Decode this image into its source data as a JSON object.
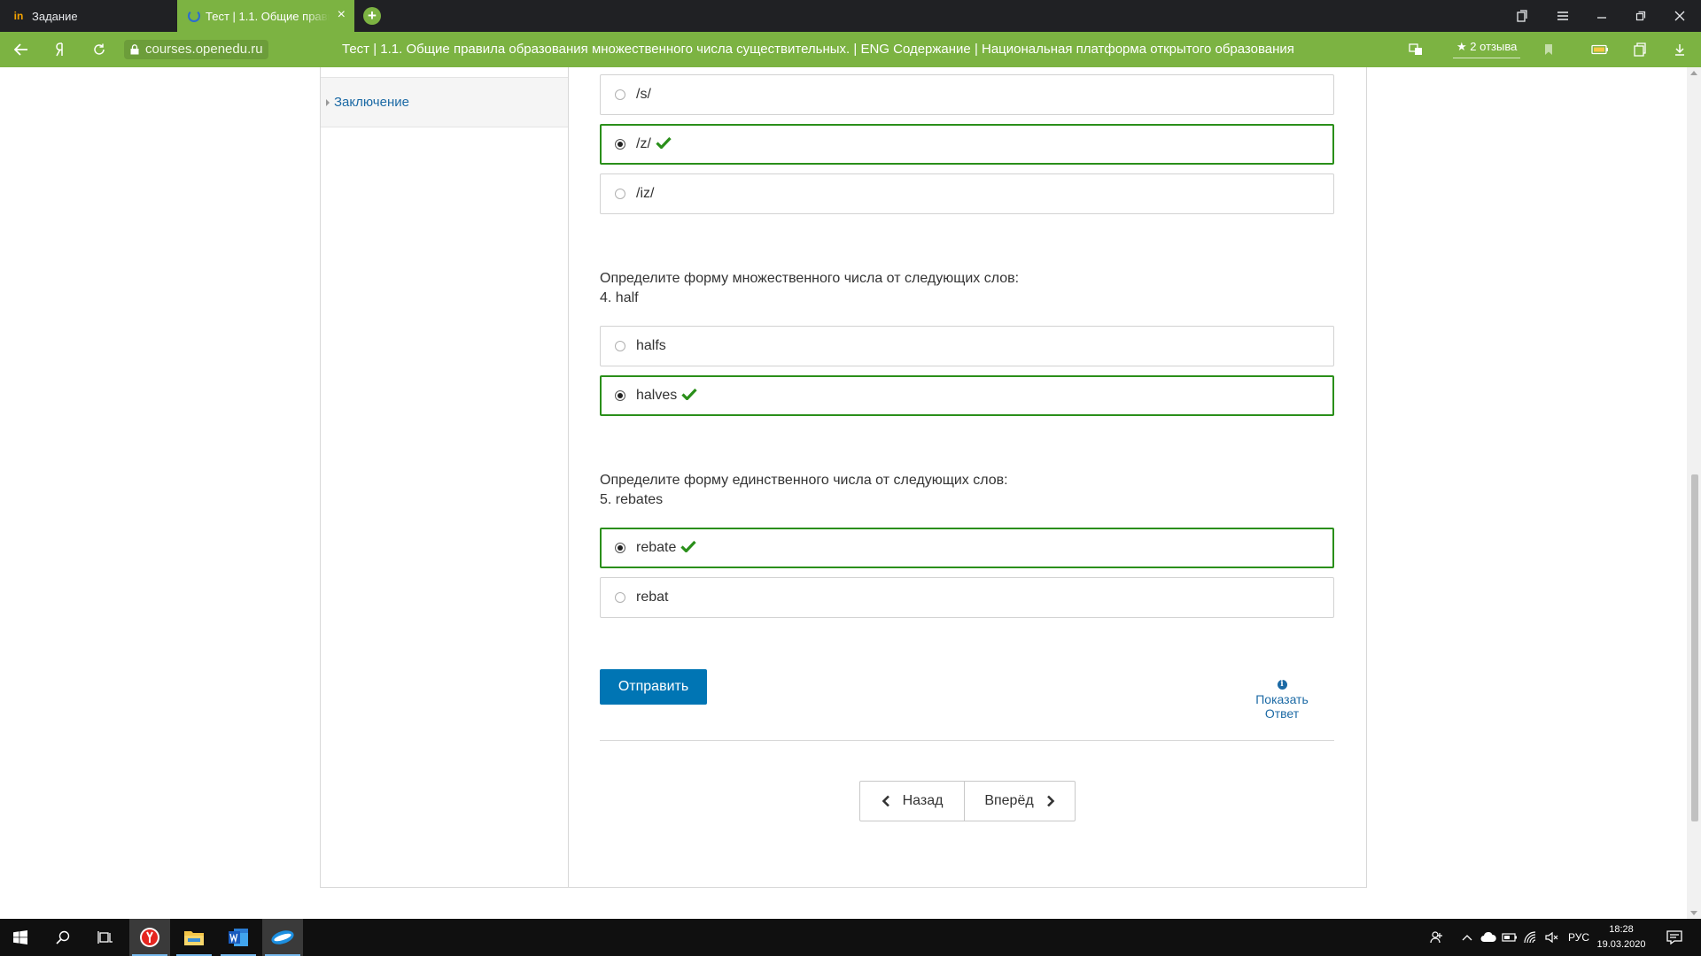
{
  "browser": {
    "tabs": [
      {
        "label": "Задание",
        "favicon": "in"
      },
      {
        "label": "Тест | 1.1. Общие правила образования",
        "favicon": "openedu-logo"
      }
    ],
    "close_glyph": "×",
    "new_tab_glyph": "+",
    "url": "courses.openedu.ru",
    "page_title": "Тест | 1.1. Общие правила образования множественного числа существительных. | ENG Содержание | Национальная платформа открытого образования",
    "reviews": "2 отзыва",
    "accent_color": "#7cb342"
  },
  "sidebar": {
    "items": [
      {
        "label": "Заключение"
      }
    ]
  },
  "quiz": {
    "q3_options": [
      {
        "label": "/s/",
        "selected": false
      },
      {
        "label": "/z/",
        "selected": true,
        "correct": true
      },
      {
        "label": "/iz/",
        "selected": false
      }
    ],
    "q4": {
      "prompt": "Определите форму множественного числа от следующих слов:",
      "word": "4. half",
      "options": [
        {
          "label": "halfs",
          "selected": false
        },
        {
          "label": "halves",
          "selected": true,
          "correct": true
        }
      ]
    },
    "q5": {
      "prompt": "Определите форму единственного числа от следующих слов:",
      "word": "5. rebates",
      "options": [
        {
          "label": "rebate",
          "selected": true,
          "correct": true
        },
        {
          "label": "rebat",
          "selected": false
        }
      ]
    },
    "submit_label": "Отправить",
    "show_answer_line1": "Показать",
    "show_answer_line2": "Ответ",
    "info_glyph": "i",
    "correct_color": "#2a8f1a",
    "submit_color": "#0075b4"
  },
  "pager": {
    "prev_label": "Назад",
    "next_label": "Вперёд"
  },
  "taskbar": {
    "language": "РУС",
    "time": "18:28",
    "date": "19.03.2020"
  }
}
